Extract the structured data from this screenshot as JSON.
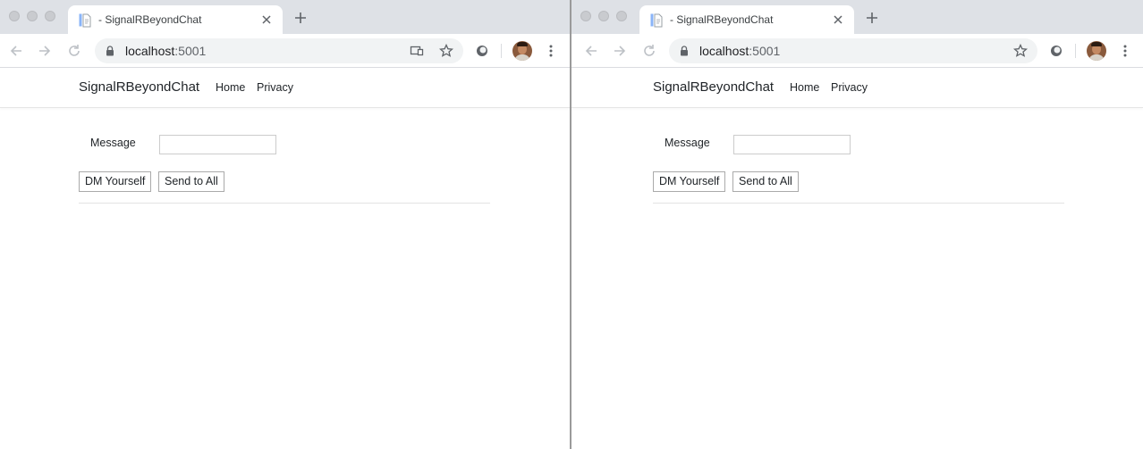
{
  "left": {
    "tab": {
      "title": "- SignalRBeyondChat"
    },
    "address": {
      "host": "localhost",
      "port": ":5001"
    },
    "site": {
      "brand": "SignalRBeyondChat",
      "nav": [
        "Home",
        "Privacy"
      ],
      "message_label": "Message",
      "message_value": "",
      "dm_button": "DM Yourself",
      "send_all_button": "Send to All"
    }
  },
  "right": {
    "tab": {
      "title": "- SignalRBeyondChat"
    },
    "address": {
      "host": "localhost",
      "port": ":5001"
    },
    "site": {
      "brand": "SignalRBeyondChat",
      "nav": [
        "Home",
        "Privacy"
      ],
      "message_label": "Message",
      "message_value": "",
      "dm_button": "DM Yourself",
      "send_all_button": "Send to All"
    }
  },
  "icons": {
    "favicon": "document-icon",
    "close": "close-icon",
    "new_tab": "plus-icon",
    "back": "back-arrow-icon",
    "forward": "forward-arrow-icon",
    "reload": "reload-icon",
    "lock": "lock-icon",
    "cast": "cast-icon",
    "bookmark": "star-icon",
    "extension": "extension-icon",
    "menu": "kebab-menu-icon"
  },
  "colors": {
    "tab_strip": "#dee1e6",
    "omnibox": "#f1f3f4",
    "text": "#212529"
  }
}
